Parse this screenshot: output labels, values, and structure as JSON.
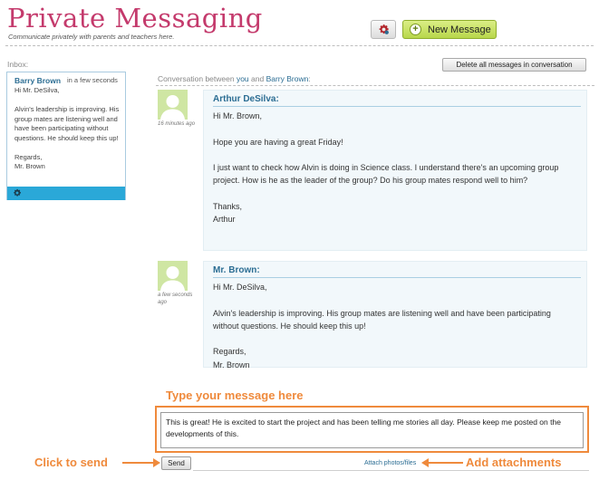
{
  "header": {
    "title": "Private Messaging",
    "subtitle": "Communicate privately with parents and teachers here.",
    "new_message_label": "New Message"
  },
  "icons": {
    "settings": "gear-icon",
    "new_message": "plus-icon",
    "avatar": "user-silhouette-icon"
  },
  "inbox": {
    "label": "Inbox:",
    "item": {
      "name": "Barry Brown",
      "time": "in a few seconds",
      "preview": [
        "Hi Mr. DeSilva,",
        "Alvin's leadership is improving. His group mates are listening well and have been participating without questions. He should keep this up!",
        "Regards,\nMr. Brown"
      ]
    }
  },
  "conversation": {
    "delete_all_label": "Delete all messages in conversation",
    "header_prefix": "Conversation between ",
    "header_you": "you",
    "header_and": " and ",
    "header_contact": "Barry Brown",
    "header_suffix": ":",
    "messages": [
      {
        "sender": "Arthur DeSilva:",
        "time": "16 minutes ago",
        "paragraphs": [
          "Hi Mr. Brown,",
          "Hope you are having a great Friday!",
          "I just want to check how Alvin is doing in Science class. I understand there's an upcoming group project. How is he as the leader of the group? Do his group mates respond well to him?",
          "",
          "Thanks,\nArthur"
        ]
      },
      {
        "sender": "Mr. Brown:",
        "time": "a few seconds ago",
        "paragraphs": [
          "Hi Mr. DeSilva,",
          "Alvin's leadership is improving. His group mates are listening well and have been participating without questions. He should keep this up!",
          "Regards,\nMr. Brown"
        ]
      }
    ]
  },
  "compose": {
    "callout": "Type your message here",
    "value": "This is great! He is excited to start the project and has been telling me stories all day. Please keep me posted on the developments of this.",
    "send_label": "Send",
    "attach_label": "Attach photos/files"
  },
  "annotations": {
    "send_callout": "Click to send",
    "attach_callout": "Add attachments"
  },
  "colors": {
    "title": "#c43a6c",
    "accent": "#2aa8d8",
    "link": "#2b6d93",
    "callout": "#ef8a3c",
    "new_message_button": "#c4df5d"
  }
}
